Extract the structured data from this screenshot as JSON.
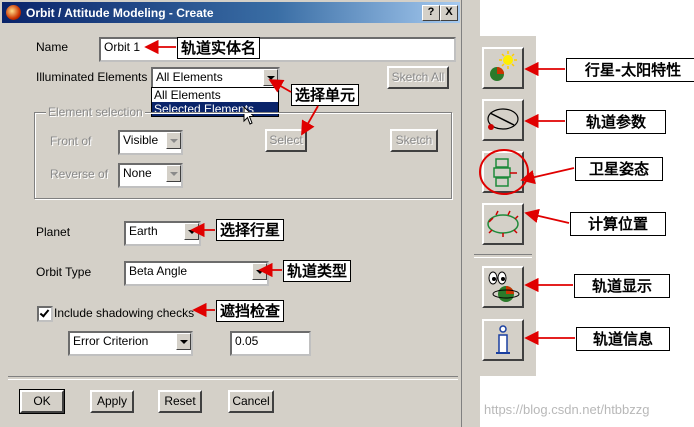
{
  "window": {
    "title": "Orbit / Attitude Modeling - Create",
    "help_button": "?",
    "close_button": "X"
  },
  "form": {
    "name_label": "Name",
    "name_value": "Orbit 1",
    "illuminated_label": "Illuminated Elements",
    "illuminated_value": "All Elements",
    "illuminated_options": [
      "All Elements",
      "Selected Elements"
    ],
    "sketch_all_label": "Sketch All",
    "element_selection_label": "Element selection",
    "front_of_label": "Front of",
    "front_of_value": "Visible",
    "select_button": "Select",
    "sketch_button": "Sketch",
    "reverse_of_label": "Reverse of",
    "reverse_of_value": "None",
    "planet_label": "Planet",
    "planet_value": "Earth",
    "orbit_type_label": "Orbit Type",
    "orbit_type_value": "Beta Angle",
    "shadowing_label": "Include shadowing checks",
    "shadowing_checked": true,
    "criterion_value": "Error Criterion",
    "criterion_number": "0.05"
  },
  "buttons": {
    "ok": "OK",
    "apply": "Apply",
    "reset": "Reset",
    "cancel": "Cancel"
  },
  "annotations": {
    "name": "轨道实体名",
    "select_element": "选择单元",
    "select_planet": "选择行星",
    "orbit_type": "轨道类型",
    "shadowing": "遮挡检查",
    "planet_sun": "行星-太阳特性",
    "orbit_params": "轨道参数",
    "attitude": "卫星姿态",
    "calc_position": "计算位置",
    "orbit_display": "轨道显示",
    "orbit_info": "轨道信息"
  },
  "watermark": "https://blog.csdn.net/htbbzzg",
  "colors": {
    "titlebar": "#0a246a",
    "dialog_bg": "#d4d0c8",
    "annotation_arrow": "#e00000",
    "selection": "#0a246a"
  },
  "icons": [
    "planet-sun-icon",
    "orbit-parameters-icon",
    "satellite-attitude-icon",
    "compute-position-icon",
    "orbit-display-icon",
    "info-icon"
  ]
}
